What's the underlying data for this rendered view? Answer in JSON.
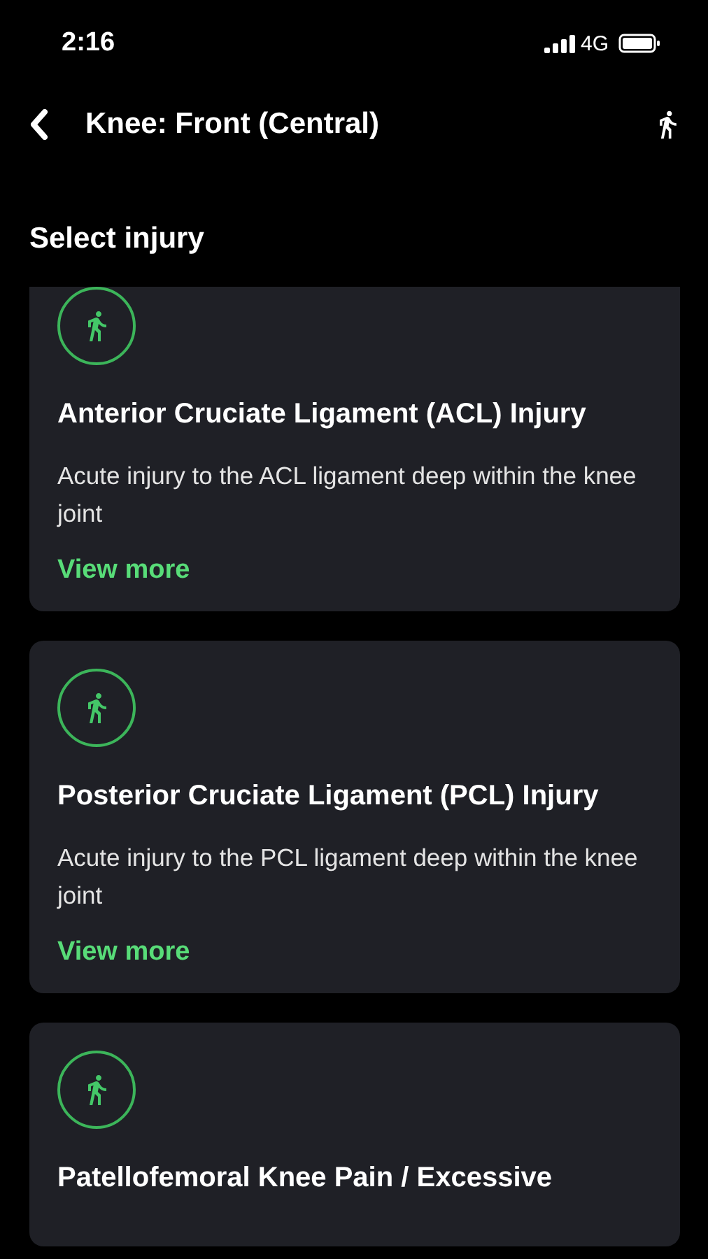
{
  "status_bar": {
    "time": "2:16",
    "network": "4G"
  },
  "header": {
    "title": "Knee: Front (Central)"
  },
  "section_title": "Select injury",
  "injuries": [
    {
      "title": "Anterior Cruciate Ligament (ACL) Injury",
      "description": "Acute injury to the ACL ligament deep within the knee joint",
      "link": "View more"
    },
    {
      "title": "Posterior Cruciate Ligament (PCL) Injury",
      "description": "Acute injury to the PCL ligament deep within the knee joint",
      "link": "View more"
    },
    {
      "title": "Patellofemoral Knee Pain / Excessive"
    }
  ]
}
